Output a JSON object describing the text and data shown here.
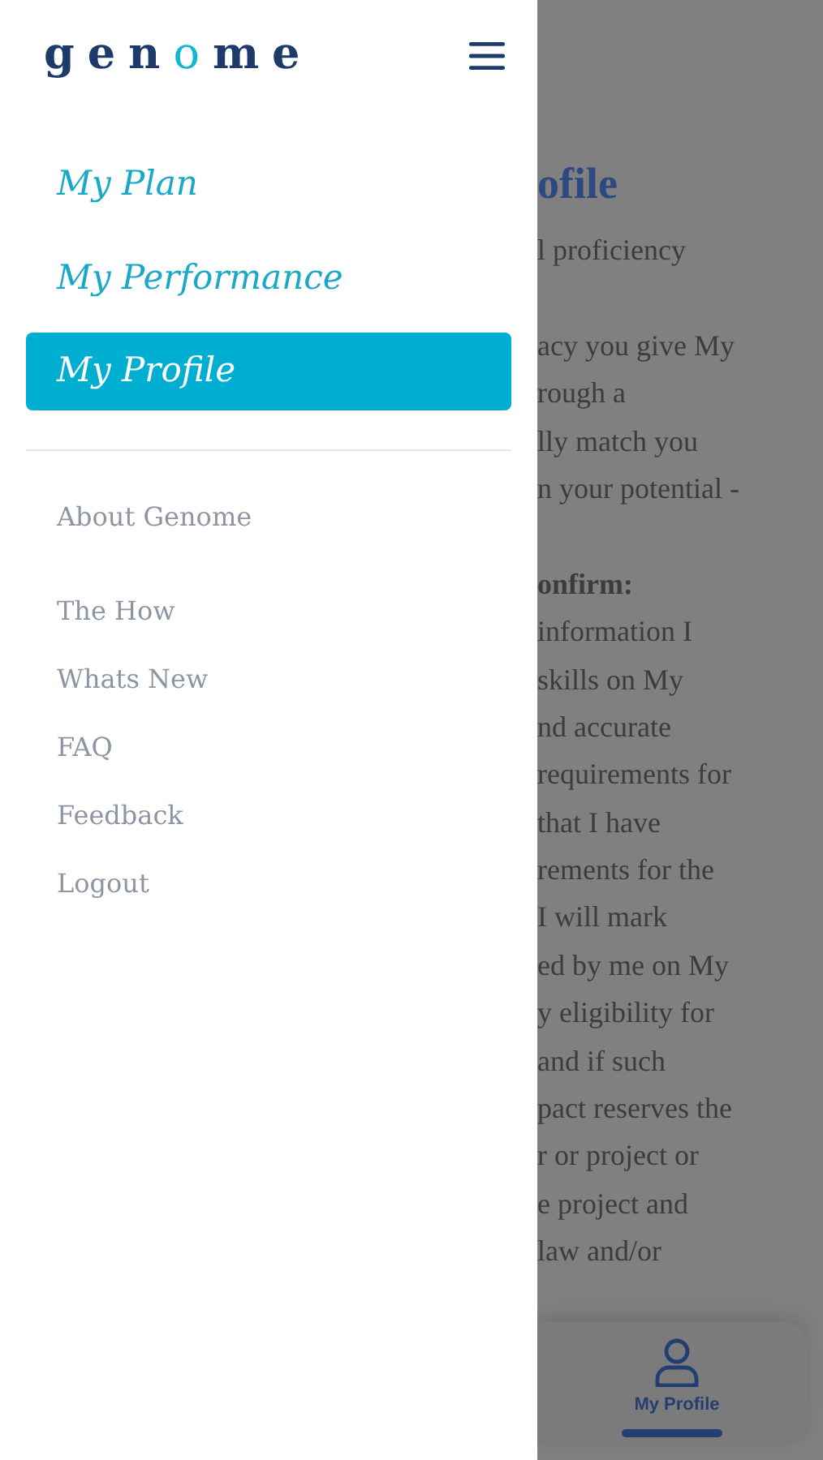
{
  "drawer": {
    "logo": [
      {
        "text": "gen",
        "accent": false
      },
      {
        "text": "o",
        "accent": true
      },
      {
        "text": "me",
        "accent": false
      }
    ],
    "primary_nav": [
      {
        "label": "My Plan",
        "selected": false
      },
      {
        "label": "My Performance",
        "selected": false
      },
      {
        "label": "My Profile",
        "selected": true
      }
    ],
    "secondary_nav": [
      {
        "label": "About Genome"
      },
      {
        "label": "The How"
      },
      {
        "label": "Whats New"
      },
      {
        "label": "FAQ"
      },
      {
        "label": "Feedback"
      },
      {
        "label": "Logout"
      }
    ]
  },
  "background_page": {
    "title": "ofile",
    "lines": [
      {
        "text": "l proficiency",
        "bold": false
      },
      {
        "text": "acy you give My",
        "bold": false,
        "paragraph_start": true
      },
      {
        "text": "rough a",
        "bold": false
      },
      {
        "text": "lly match you",
        "bold": false
      },
      {
        "text": "n your potential -",
        "bold": false
      },
      {
        "text": "onfirm:",
        "bold": true,
        "paragraph_start": true
      },
      {
        "text": "information I",
        "bold": false
      },
      {
        "text": "skills on My",
        "bold": false
      },
      {
        "text": "nd accurate",
        "bold": false
      },
      {
        "text": "requirements for",
        "bold": false
      },
      {
        "text": "that I have",
        "bold": false
      },
      {
        "text": "rements for the",
        "bold": false
      },
      {
        "text": "I will mark",
        "bold": false
      },
      {
        "text": "ed by me on My",
        "bold": false
      },
      {
        "text": "y eligibility for",
        "bold": false
      },
      {
        "text": "and if such",
        "bold": false
      },
      {
        "text": "pact reserves the",
        "bold": false
      },
      {
        "text": "r or project or",
        "bold": false
      },
      {
        "text": "e project and",
        "bold": false
      },
      {
        "text": "law and/or",
        "bold": false
      }
    ],
    "tab_bar": [
      {
        "label": "My Profile",
        "selected": true
      }
    ]
  }
}
